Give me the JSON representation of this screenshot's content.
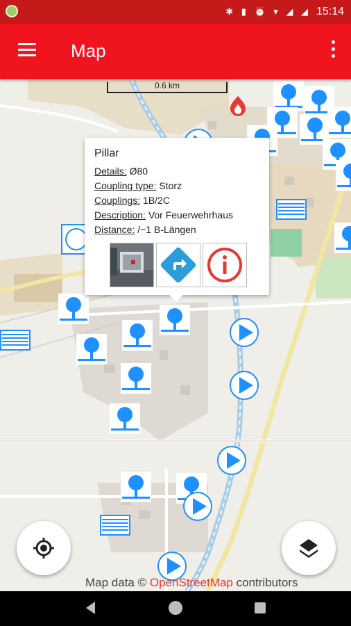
{
  "app": {
    "title": "Map",
    "clock": "15:14",
    "battery": "80"
  },
  "map": {
    "scale_label": "0.6 km",
    "attribution_prefix": "Map data ©",
    "attribution_link": "OpenStreetMap",
    "attribution_suffix": "contributors"
  },
  "popup": {
    "title": "Pillar",
    "rows": [
      {
        "key": "Details:",
        "value": "Ø80"
      },
      {
        "key": "Coupling type:",
        "value": "Storz"
      },
      {
        "key": "Couplings:",
        "value": "1B/2C"
      },
      {
        "key": "Description:",
        "value": "Vor Feuerwehrhaus"
      },
      {
        "key": "Distance:",
        "value": "/~1 B-Längen"
      }
    ]
  },
  "colors": {
    "appbar": "#f0141e",
    "statusbar": "#c61a1a",
    "marker": "#1e90ff",
    "accent": "#e53935"
  },
  "icons": [
    "menu-icon",
    "more-icon",
    "my-location-icon",
    "layers-icon",
    "fire-station-icon",
    "pillar-hydrant-icon",
    "direction-icon",
    "info-icon"
  ]
}
